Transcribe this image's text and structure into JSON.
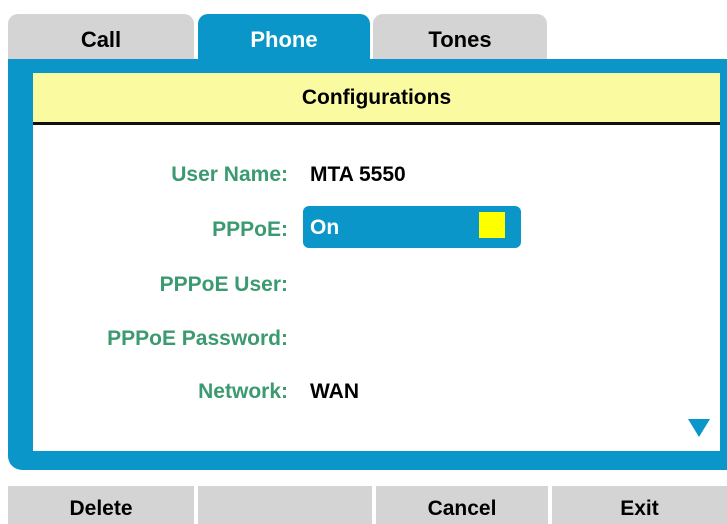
{
  "tabs": [
    {
      "label": "Call",
      "active": false
    },
    {
      "label": "Phone",
      "active": true
    },
    {
      "label": "Tones",
      "active": false
    }
  ],
  "panel": {
    "title": "Configurations"
  },
  "fields": {
    "user_name": {
      "label": "User Name:",
      "value": "MTA 5550"
    },
    "pppoe": {
      "label": "PPPoE:",
      "value": "On",
      "checked": true
    },
    "pppoe_user": {
      "label": "PPPoE User:",
      "value": ""
    },
    "pppoe_password": {
      "label": "PPPoE Password:",
      "value": ""
    },
    "network": {
      "label": "Network:",
      "value": "WAN"
    }
  },
  "softkeys": [
    "Delete",
    "",
    "Cancel",
    "Exit"
  ],
  "icons": {
    "scroll_down": "triangle-down-icon",
    "checkbox": "checkbox-icon"
  },
  "colors": {
    "accent_blue": "#0a96c8",
    "header_yellow": "#fafaa0",
    "label_green": "#3c9a70",
    "checkbox_yellow": "#ffff00",
    "inactive_gray": "#d4d4d4"
  }
}
